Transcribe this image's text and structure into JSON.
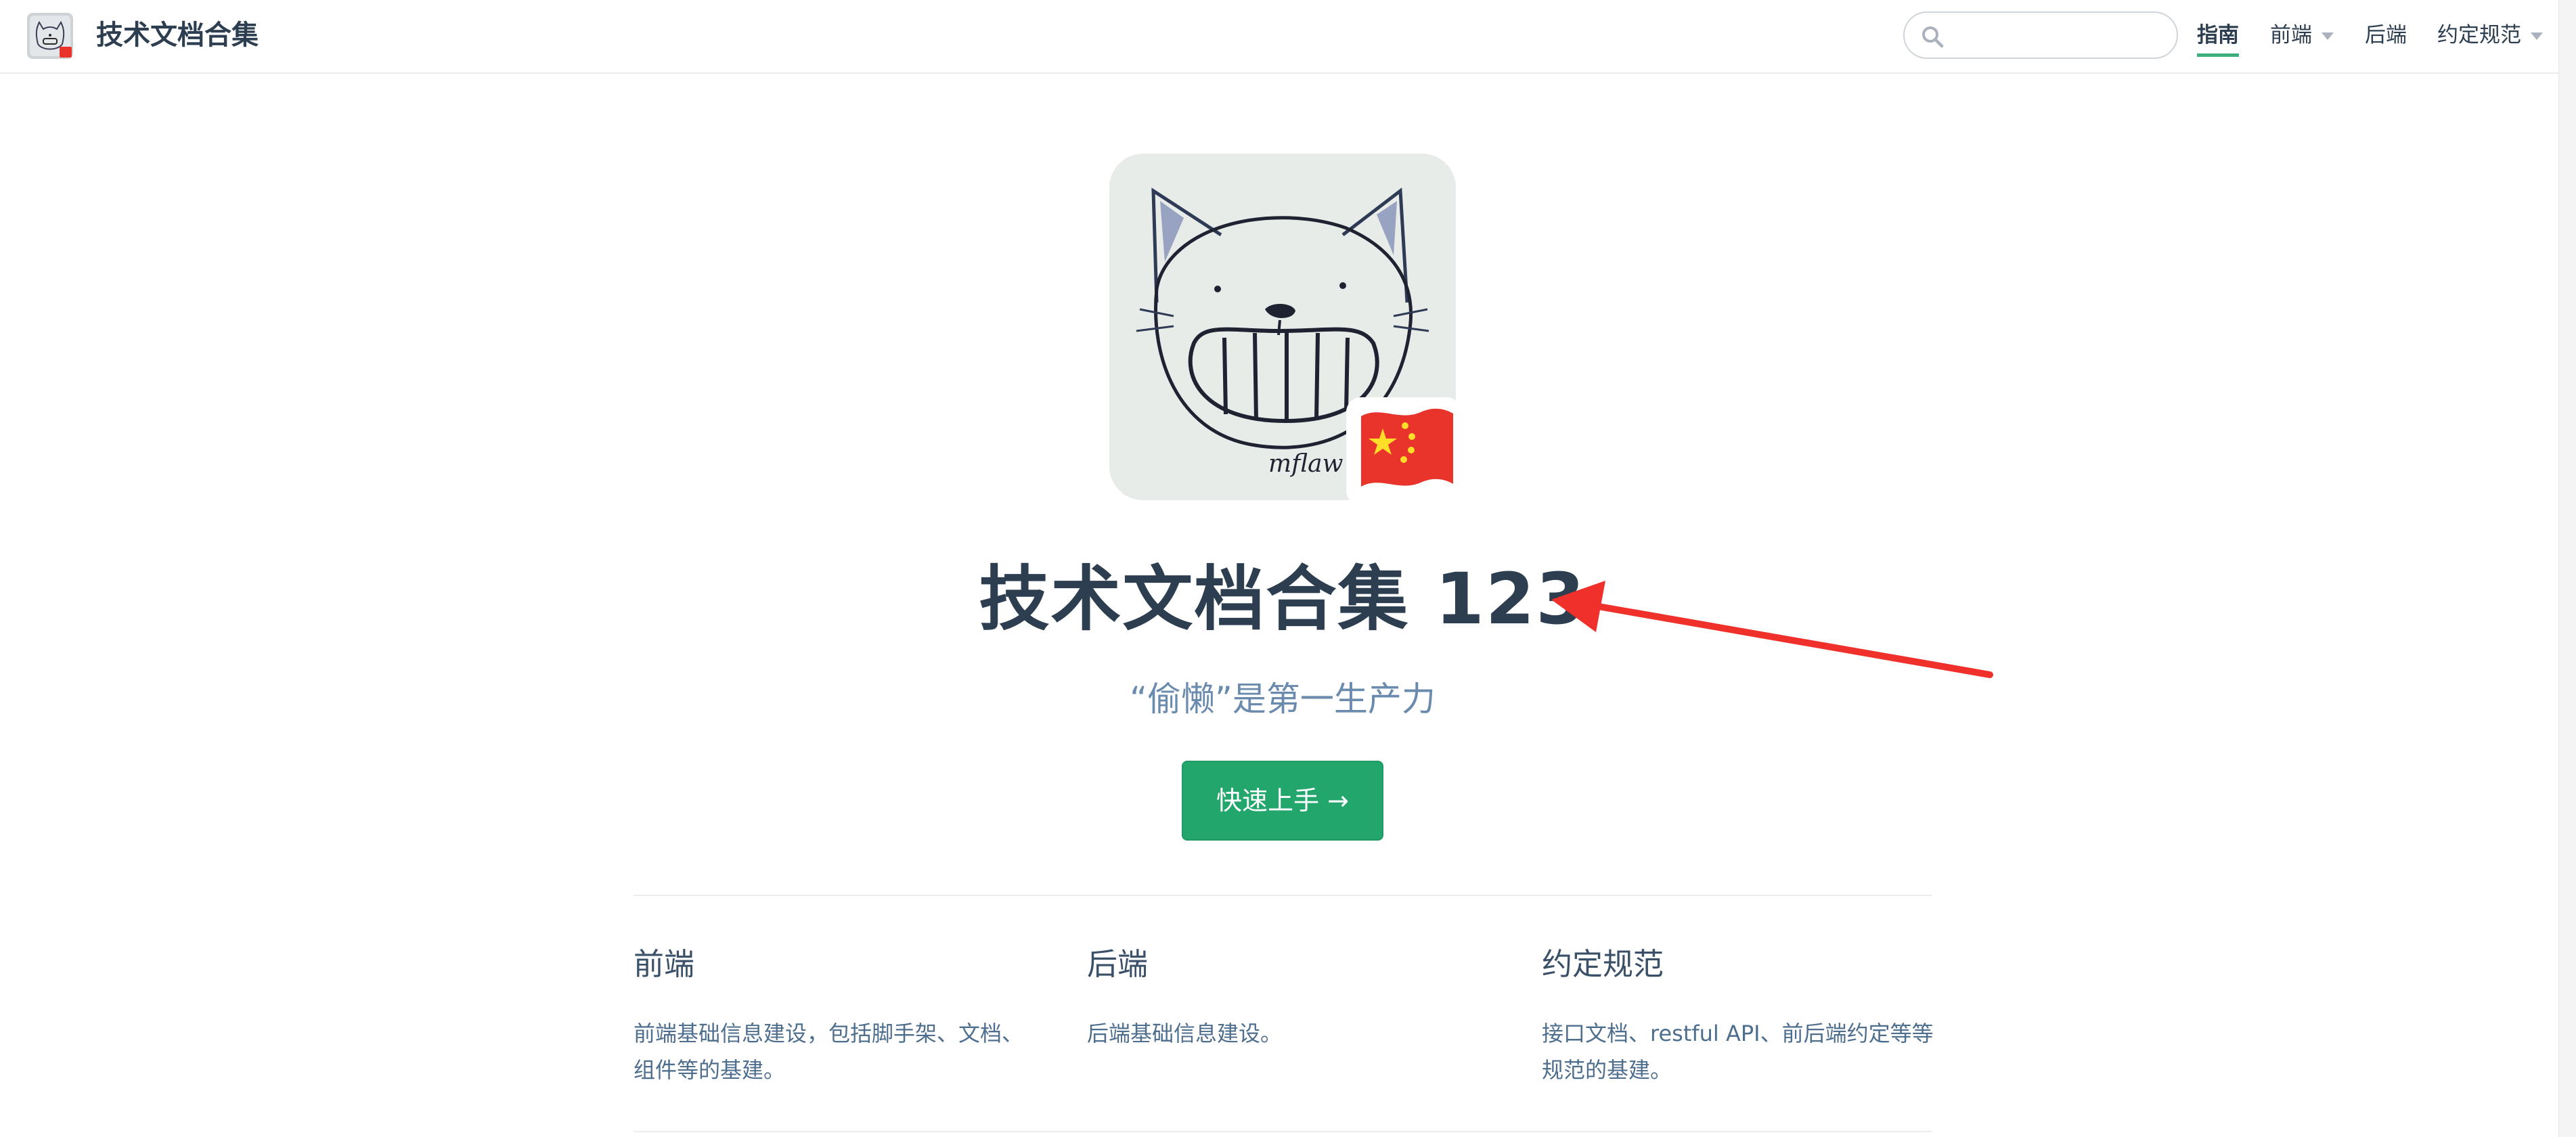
{
  "navbar": {
    "title": "技术文档合集",
    "logo_icon": "cat-drawing-logo-icon",
    "search": {
      "placeholder": "",
      "value": "",
      "icon": "search-icon"
    },
    "links": [
      {
        "label": "指南",
        "active": true,
        "dropdown": false
      },
      {
        "label": "前端",
        "active": false,
        "dropdown": true
      },
      {
        "label": "后端",
        "active": false,
        "dropdown": false
      },
      {
        "label": "约定规范",
        "active": false,
        "dropdown": true
      }
    ]
  },
  "hero": {
    "image_icon": "cat-sketch-with-flag-icon",
    "signature_text": "mflaw",
    "title": "技术文档合集 123",
    "description": "“偷懒”是第一生产力",
    "action_label": "快速上手 →"
  },
  "features": [
    {
      "title": "前端",
      "details": "前端基础信息建设，包括脚手架、文档、组件等的基建。"
    },
    {
      "title": "后端",
      "details": "后端基础信息建设。"
    },
    {
      "title": "约定规范",
      "details": "接口文档、restful API、前后端约定等等规范的基建。"
    }
  ],
  "colors": {
    "accent": "#3eaf7c",
    "button": "#22a66c",
    "text": "#2c3e50",
    "description": "#6a8bad",
    "annotation_arrow": "#f0302a"
  }
}
